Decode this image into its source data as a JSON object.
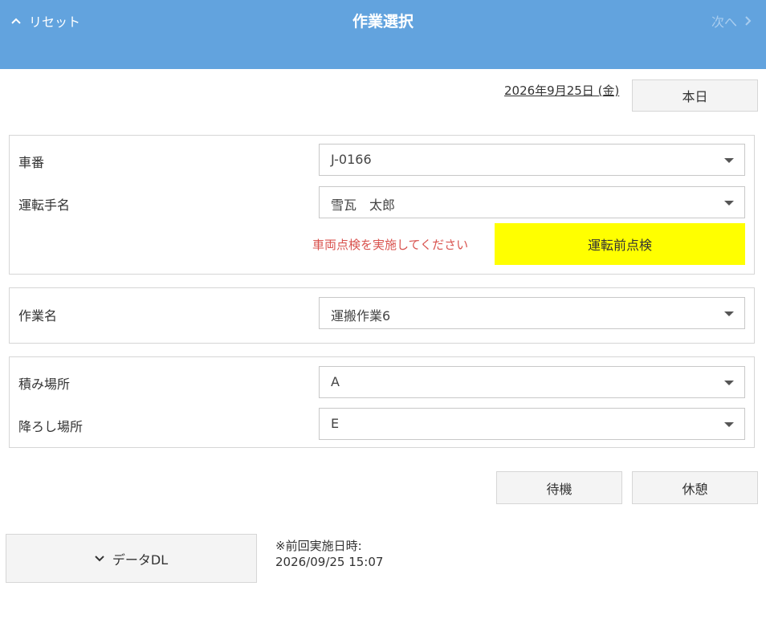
{
  "header": {
    "left_label": "リセット",
    "title": "作業選択",
    "right_label": "次へ"
  },
  "date": {
    "display": "2026年9月25日 (金)",
    "today_button": "本日"
  },
  "vehicle_panel": {
    "vehicle_label": "車番",
    "vehicle_value": "J-0166",
    "driver_label": "運転手名",
    "driver_value": "雪瓦　太郎",
    "warning": "車両点検を実施してください",
    "inspection_button": "運転前点検",
    "inspection_color": "#ffff00"
  },
  "work_panel": {
    "work_label": "作業名",
    "work_value": "運搬作業6"
  },
  "location_panel": {
    "load_label": "積み場所",
    "load_value": "A",
    "unload_label": "降ろし場所",
    "unload_value": "E"
  },
  "status_buttons": {
    "standby": "待機",
    "rest": "休憩"
  },
  "data_dl": {
    "button": "データDL",
    "last_run_label": "※前回実施日時:",
    "last_run_value": "2026/09/25 15:07"
  },
  "colors": {
    "header_bg": "#62a3de",
    "warning_text": "#d9534f"
  },
  "icons": {
    "reset": "chevron-up-icon",
    "next": "chevron-right-icon",
    "dropdown": "caret-down-icon",
    "data_dl": "chevron-down-icon"
  }
}
